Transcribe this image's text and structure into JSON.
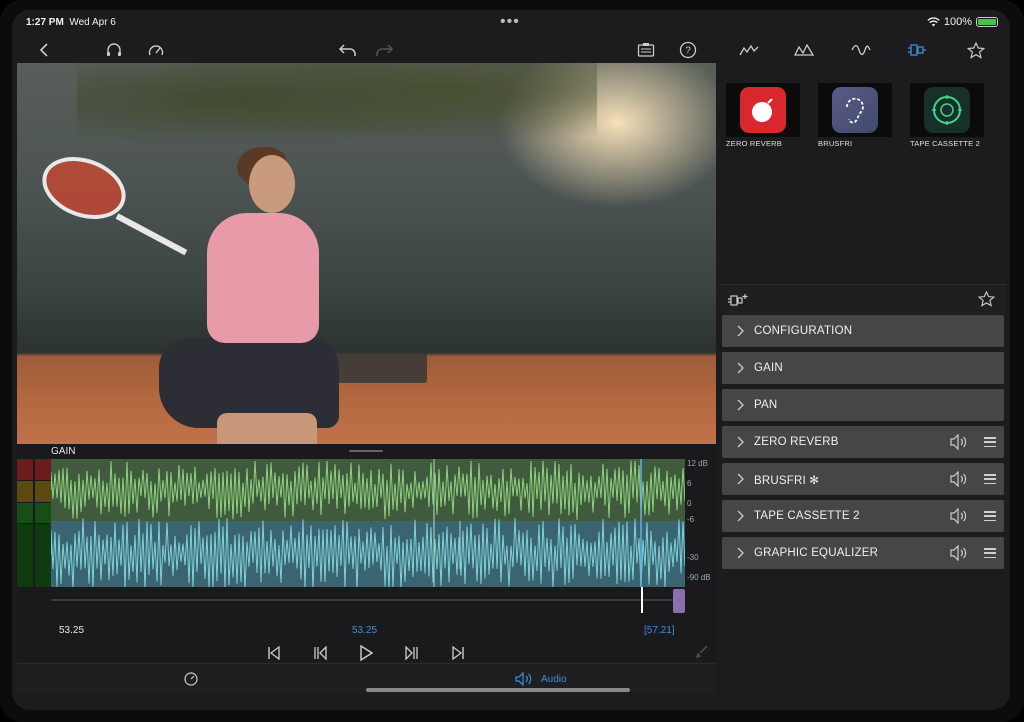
{
  "status_bar": {
    "time": "1:27 PM",
    "date": "Wed Apr 6",
    "battery_label": "100%",
    "battery_level_pct": 100,
    "battery_color": "#46c14a"
  },
  "toolbar": {
    "icons": [
      "back-icon",
      "headphones-icon",
      "speedometer-icon",
      "undo-icon",
      "redo-icon",
      "clipboard-icon",
      "help-icon"
    ]
  },
  "timeline": {
    "track_label": "GAIN",
    "db_labels": [
      "12 dB",
      "6",
      "0",
      "-6",
      "-30",
      "-90 dB"
    ],
    "time_left": "53.25",
    "time_center": "53.25",
    "time_right": "[57.21]",
    "accent_color": "#3f8ed6"
  },
  "bottom_bar": {
    "audio_label": "Audio"
  },
  "right_panel": {
    "tabs": [
      "envelope-icon",
      "spectrum-icon",
      "waveform-icon",
      "plugin-icon",
      "star-icon"
    ],
    "active_tab": "plugin-icon",
    "plugins": [
      {
        "label": "ZERO REVERB"
      },
      {
        "label": "BRUSFRI"
      },
      {
        "label": "TAPE CASSETTE 2"
      }
    ],
    "sections": [
      {
        "label": "CONFIGURATION"
      },
      {
        "label": "GAIN"
      },
      {
        "label": "PAN"
      },
      {
        "label": "ZERO REVERB"
      },
      {
        "label": "BRUSFRI ✻"
      },
      {
        "label": "TAPE CASSETTE 2"
      },
      {
        "label": "GRAPHIC EQUALIZER"
      }
    ]
  }
}
